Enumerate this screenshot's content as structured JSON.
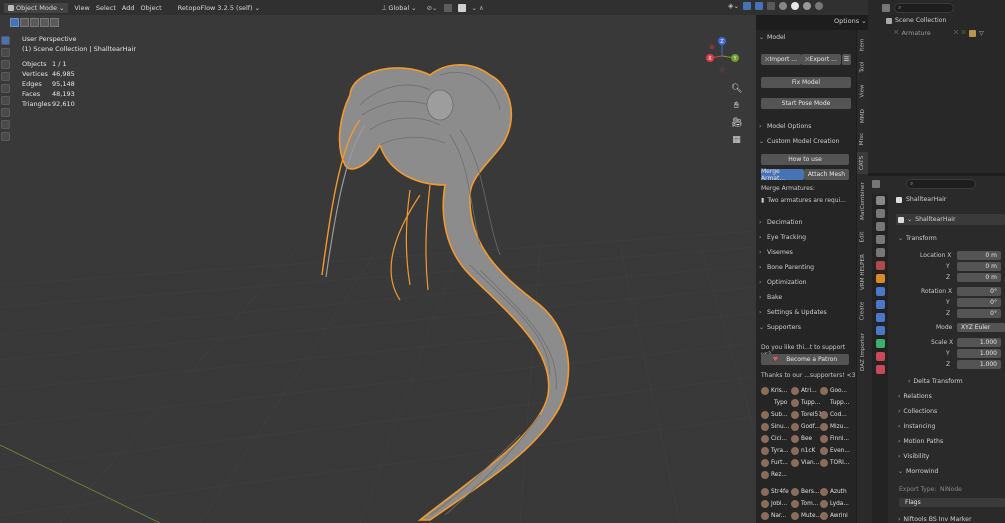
{
  "header": {
    "mode": "Object Mode",
    "menus": [
      "View",
      "Select",
      "Add",
      "Object"
    ],
    "addon": "RetopoFlow 3.2.5 (self)",
    "orientation": "Global",
    "options": "Options"
  },
  "viewport": {
    "perspective": "User Perspective",
    "collection": "(1) Scene Collection | ShalltearHair",
    "stats": [
      {
        "label": "Objects",
        "value": "1 / 1"
      },
      {
        "label": "Vertices",
        "value": "46,985"
      },
      {
        "label": "Edges",
        "value": "95,148"
      },
      {
        "label": "Faces",
        "value": "48,193"
      },
      {
        "label": "Triangles",
        "value": "92,610"
      }
    ],
    "gizmo": {
      "z": "Z",
      "y": "Y",
      "x": "X"
    }
  },
  "npanel": {
    "model": "Model",
    "import": "Import ...",
    "export": "Export ...",
    "fix_model": "Fix Model",
    "start_pose": "Start Pose Mode",
    "model_options": "Model Options",
    "custom_creation": "Custom Model Creation",
    "how_to_use": "How to use",
    "merge_armat": "Merge Armat...",
    "attach_mesh": "Attach Mesh",
    "merge_armatures": "Merge Armatures:",
    "warning": "Two armatures are requi...",
    "sections": [
      "Decimation",
      "Eye Tracking",
      "Visemes",
      "Bone Parenting",
      "Optimization",
      "Bake",
      "Settings & Updates"
    ],
    "supporters": "Supporters",
    "support_q": "Do you like thi...t to support us?",
    "become_patron": "Become a Patron",
    "thanks": "Thanks to our ...supporters! <3",
    "supporter_names": [
      [
        "Kris...",
        "Atri...",
        "Goo..."
      ],
      [
        "Typo",
        "Tupp...",
        "Tupp..."
      ],
      [
        "Sub...",
        "Torel51",
        "Cod..."
      ],
      [
        "Sinu...",
        "Godf...",
        "Mizu..."
      ],
      [
        "Cici...",
        "Bee",
        "Finni..."
      ],
      [
        "Tyra...",
        "n1cK",
        "Even..."
      ],
      [
        "Furt...",
        "Vian...",
        "TORI..."
      ],
      [
        "Rez...",
        "",
        ""
      ],
      [
        "Str4fe",
        "Bers...",
        "Azuth"
      ],
      [
        "Jobl...",
        "Tom...",
        "Lyda..."
      ],
      [
        "Nar...",
        "Mute...",
        "Awrini"
      ]
    ]
  },
  "vtabs": [
    "Item",
    "Tool",
    "View",
    "MMD",
    "Misc",
    "CATS",
    "MatCombiner",
    "Edit",
    "VRM HELPER",
    "Create",
    "DAZ Importer"
  ],
  "outliner": {
    "scene_collection": "Scene Collection",
    "armature": "Armature"
  },
  "properties": {
    "object_name": "ShalltearHair",
    "data_name": "ShalltearHair",
    "transform": "Transform",
    "location_x_label": "Location X",
    "location": [
      "0 m",
      "0 m",
      "0 m"
    ],
    "rotation_x_label": "Rotation X",
    "rotation": [
      "0°",
      "0°",
      "0°"
    ],
    "mode_label": "Mode",
    "mode": "XYZ Euler",
    "scale_x_label": "Scale X",
    "scale": [
      "1.000",
      "1.000",
      "1.000"
    ],
    "y_label": "Y",
    "z_label": "Z",
    "delta": "Delta Transform",
    "sections": [
      "Relations",
      "Collections",
      "Instancing",
      "Motion Paths",
      "Visibility"
    ],
    "morrowind": "Morrowind",
    "export_type_label": "Export Type:",
    "export_type": "NiNode",
    "flags": "Flags",
    "niftools": "Niftools BS Inv Marker"
  },
  "colors": {
    "accent": "#4772b3",
    "outline": "#f29a2e",
    "hair": "#8c8c8c"
  }
}
